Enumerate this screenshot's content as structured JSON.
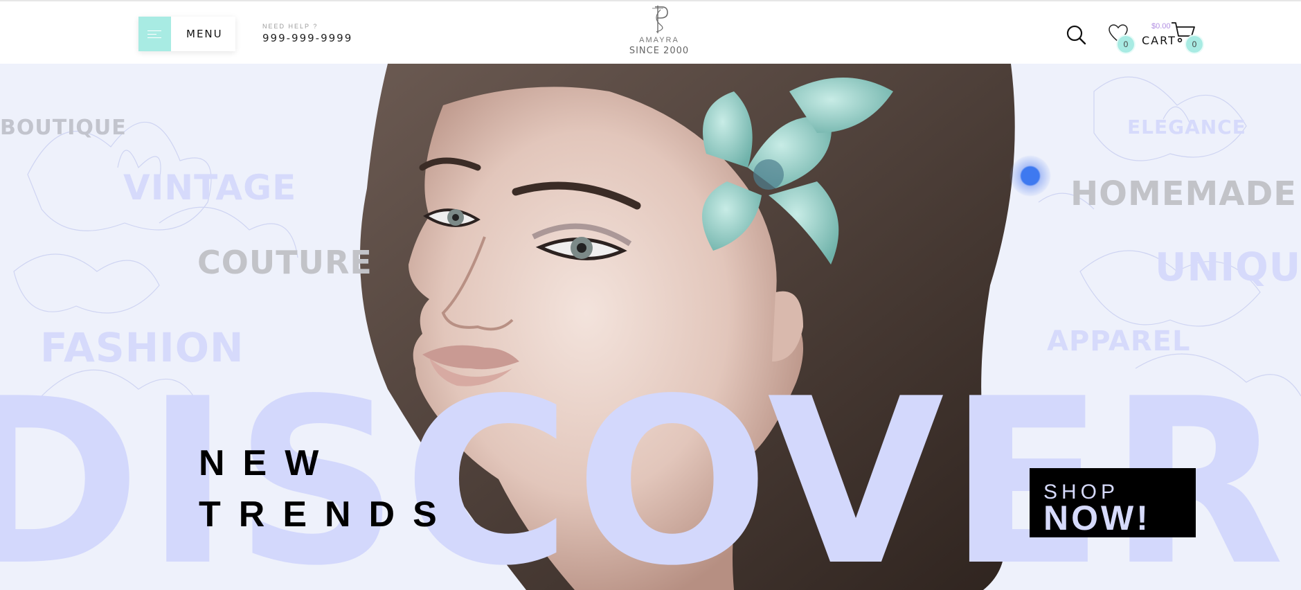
{
  "header": {
    "menu_label": "MENU",
    "help_small": "NEED HELP ?",
    "help_phone": "999-999-9999",
    "logo_brand": "AMAYRA",
    "logo_since": "SINCE 2000",
    "wishlist_count": "0",
    "cart_price": "$0.00",
    "cart_label": "CART",
    "cart_count": "0"
  },
  "hero": {
    "words": {
      "boutique": "BOUTIQUE",
      "vintage": "VINTAGE",
      "couture": "COUTURE",
      "fashion": "FASHION",
      "elegance": "ELEGANCE",
      "homemade": "HOMEMADE",
      "unique": "UNIQUE",
      "apparel": "APPAREL"
    },
    "big_word": "DISCOVER",
    "headline_line1": "NEW",
    "headline_line2": "TRENDS",
    "cta_small": "SHOP",
    "cta_big": "NOW!"
  },
  "colors": {
    "accent_mint": "#a8ebe3",
    "lavender": "#d3d8fc",
    "cart_price": "#b18ee2",
    "cta_bg": "#000000"
  },
  "icons": [
    "menu-icon",
    "search-icon",
    "heart-icon",
    "cart-icon",
    "logo-mark"
  ]
}
